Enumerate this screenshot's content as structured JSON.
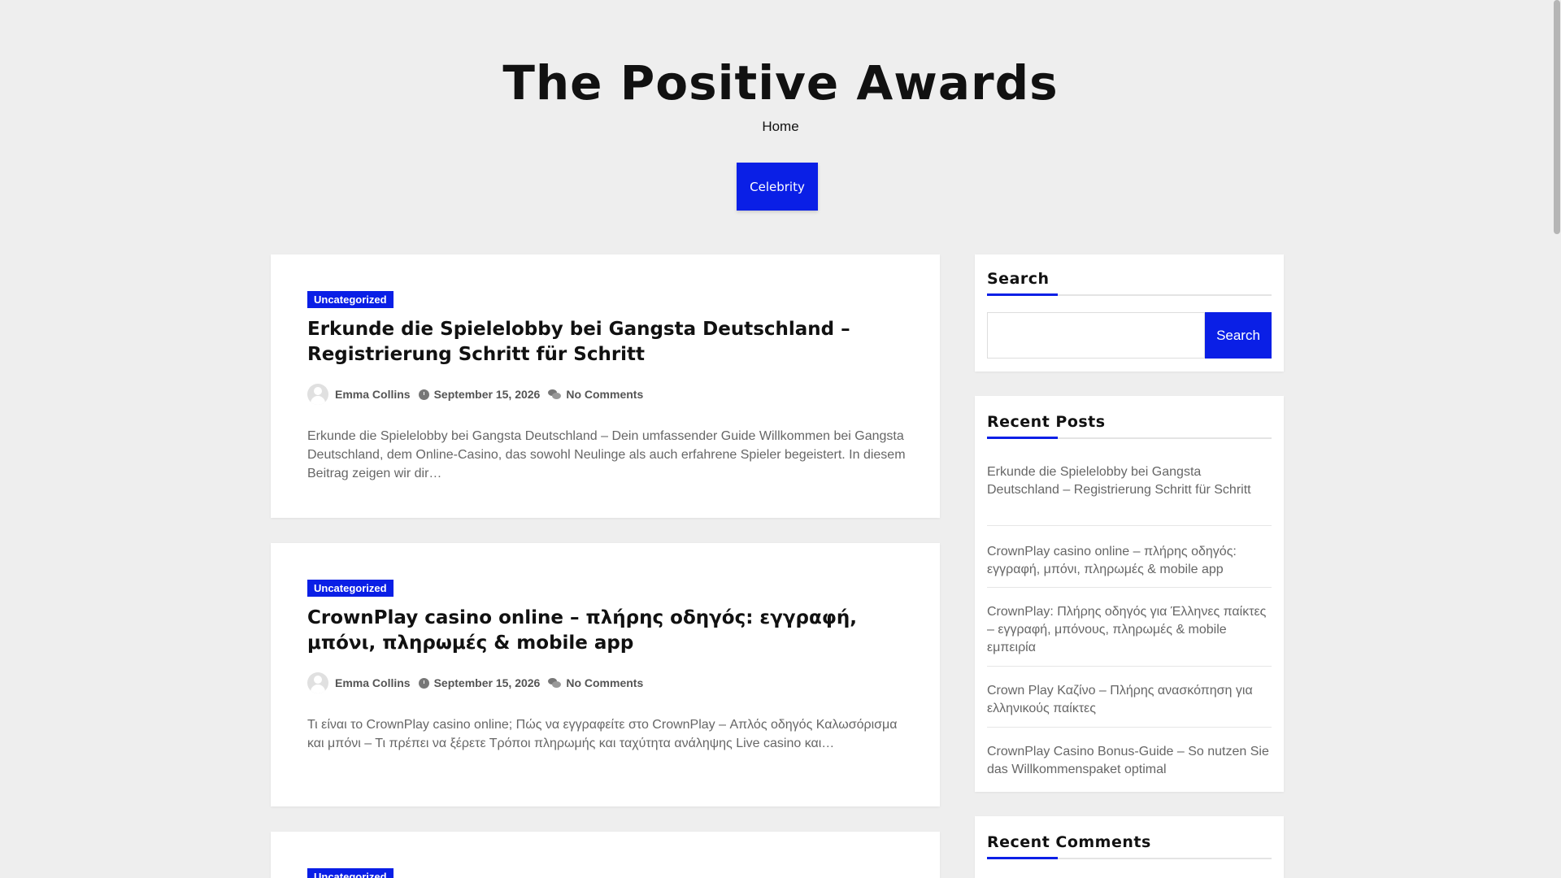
{
  "site": {
    "title": "The Positive Awards",
    "nav_home": "Home",
    "nav_button": "Celebrity"
  },
  "colors": {
    "accent": "#0a1fe6",
    "background": "#eeeeee",
    "card": "#ffffff",
    "muted_text": "#666666"
  },
  "posts": [
    {
      "category": "Uncategorized",
      "title": "Erkunde die Spielelobby bei Gangsta Deutschland – Registrierung Schritt für Schritt",
      "author": "Emma Collins",
      "date": "September 15, 2026",
      "comments": "No Comments",
      "excerpt": "Erkunde die Spielelobby bei Gangsta Deutschland – Dein umfassender Guide Willkommen bei Gangsta Deutschland, dem Online-Casino, das sowohl Neulinge als auch erfahrene Spieler begeistert. In diesem Beitrag zeigen wir dir…"
    },
    {
      "category": "Uncategorized",
      "title": "CrownPlay casino online – πλήρης οδηγός: εγγραφή, μπόνι, πληρωμές & mobile app",
      "author": "Emma Collins",
      "date": "September 15, 2026",
      "comments": "No Comments",
      "excerpt": "Τι είναι το CrownPlay casino online; Πώς να εγγραφείτε στο CrownPlay – Απλός οδηγός Καλωσόρισμα και μπόνι – Τι πρέπει να ξέρετε Τρόποι πληρωμής και ταχύτητα ανάληψης Live casino και…"
    },
    {
      "category": "Uncategorized"
    }
  ],
  "sidebar": {
    "search": {
      "title": "Search",
      "placeholder": "",
      "button": "Search"
    },
    "recent_posts": {
      "title": "Recent Posts",
      "items": [
        "Erkunde die Spielelobby bei Gangsta Deutschland – Registrierung Schritt für Schritt",
        "CrownPlay casino online – πλήρης οδηγός: εγγραφή, μπόνι, πληρωμές & mobile app",
        "CrownPlay: Πλήρης οδηγός για Έλληνες παίκτες – εγγραφή, μπόνους, πληρωμές & mobile εμπειρία",
        "Crown Play Καζίνο – Πλήρης ανασκόπηση για ελληνικούς παίκτες",
        "CrownPlay Casino Bonus-Guide – So nutzen Sie das Willkommenspaket optimal"
      ]
    },
    "recent_comments": {
      "title": "Recent Comments"
    }
  }
}
